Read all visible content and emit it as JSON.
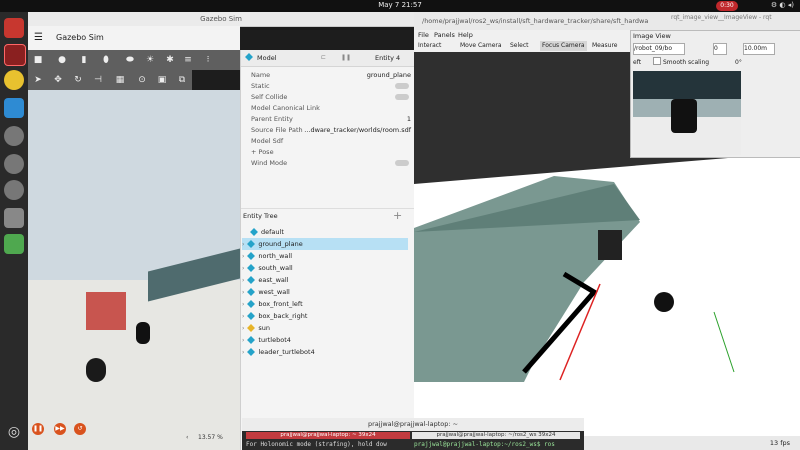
{
  "topbar": {
    "clock": "May 7  21:57",
    "recording": "0:30"
  },
  "gazebo": {
    "window_title": "Gazebo Sim",
    "app_name": "Gazebo Sim",
    "zoom": "13.57 %",
    "component_inspector": {
      "header_label": "Model",
      "entity_id": "Entity 4",
      "rows": [
        {
          "label": "Name",
          "value": "ground_plane"
        },
        {
          "label": "Static",
          "value": ""
        },
        {
          "label": "Self Collide",
          "value": ""
        },
        {
          "label": "Model Canonical Link",
          "value": ""
        },
        {
          "label": "Parent Entity",
          "value": "1"
        },
        {
          "label": "Source File Path",
          "value": "...dware_tracker/worlds/room.sdf"
        },
        {
          "label": "Model Sdf",
          "value": ""
        },
        {
          "label": "+ Pose",
          "value": ""
        },
        {
          "label": "Wind Mode",
          "value": ""
        }
      ]
    },
    "entity_tree": {
      "title": "Entity Tree",
      "items": [
        "default",
        "ground_plane",
        "north_wall",
        "south_wall",
        "east_wall",
        "west_wall",
        "box_front_left",
        "box_back_right",
        "sun",
        "turtlebot4",
        "leader_turtlebot4"
      ],
      "selected": "ground_plane"
    }
  },
  "rviz": {
    "title": "/home/prajjwal/ros2_ws/install/sft_hardware_tracker/share/sft_hardwa",
    "menu": [
      "File",
      "Panels",
      "Help"
    ],
    "tools": [
      "Interact",
      "Move Camera",
      "Select",
      "Focus Camera",
      "Measure"
    ],
    "fps": "13 fps",
    "image_view": {
      "title": "rqt_image_view__ImageView - rqt",
      "label": "Image View",
      "topic": "/robot_09/bo",
      "value": "0",
      "range": "10.00m",
      "smooth_scaling": "Smooth scaling",
      "fit_label": "eft",
      "rotation": "0°"
    }
  },
  "terminal": {
    "title": "prajjwal@prajjwal-laptop: ~",
    "tab1": "prajjwal@prajjwal-laptop: ~ 39x24",
    "tab2": "prajjwal@prajjwal-laptop: ~/ros2_ws 39x24",
    "line1": "For Holonomic mode (strafing), hold dow",
    "line2": "prajjwal@prajjwal-laptop:~/ros2_ws$ ros"
  }
}
